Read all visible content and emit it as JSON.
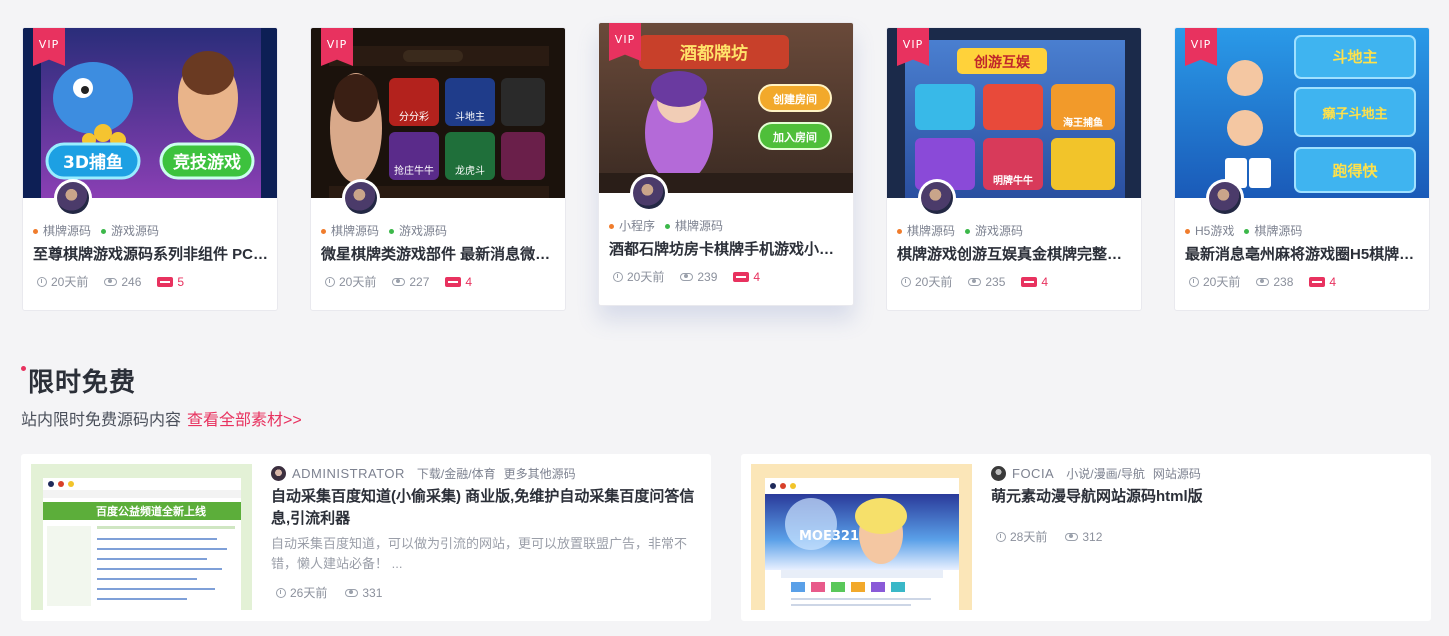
{
  "cards": [
    {
      "vip": "VIP",
      "cat1": "棋牌源码",
      "cat2": "游戏源码",
      "title": "至尊棋牌游戏源码系列非组件 PC…",
      "time": "20天前",
      "views": "246",
      "price": "5"
    },
    {
      "vip": "VIP",
      "cat1": "棋牌源码",
      "cat2": "游戏源码",
      "title": "微星棋牌类游戏部件 最新消息微…",
      "time": "20天前",
      "views": "227",
      "price": "4"
    },
    {
      "vip": "VIP",
      "cat1": "小程序",
      "cat2": "棋牌源码",
      "title": "酒都石牌坊房卡棋牌手机游戏小…",
      "time": "20天前",
      "views": "239",
      "price": "4"
    },
    {
      "vip": "VIP",
      "cat1": "棋牌源码",
      "cat2": "游戏源码",
      "title": "棋牌游戏创游互娱真金棋牌完整…",
      "time": "20天前",
      "views": "235",
      "price": "4"
    },
    {
      "vip": "VIP",
      "cat1": "H5游戏",
      "cat2": "棋牌源码",
      "title": "最新消息亳州麻将游戏圈H5棋牌…",
      "time": "20天前",
      "views": "238",
      "price": "4"
    }
  ],
  "thumb_text": {
    "c1_a": "3D捕鱼",
    "c1_b": "竞技游戏",
    "c2_a": "分分彩",
    "c2_b": "斗地主",
    "c2_c": "抢庄牛牛",
    "c2_d": "龙虎斗",
    "c3_a": "酒都牌坊",
    "c3_b": "创建房间",
    "c3_c": "加入房间",
    "c4_a": "创游互娱",
    "c4_b": "海王捕鱼",
    "c4_c": "明牌牛牛",
    "c5_a": "斗地主",
    "c5_b": "癞子斗地主",
    "c5_c": "跑得快"
  },
  "section": {
    "title": "限时免费",
    "subtitle": "站内限时免费源码内容",
    "link": "查看全部素材>>"
  },
  "list": [
    {
      "author": "ADMINISTRATOR",
      "cat1": "下载/金融/体育",
      "cat2": "更多其他源码",
      "title": "自动采集百度知道(小偷采集) 商业版,免维护自动采集百度问答信息,引流利器",
      "desc": "自动采集百度知道，可以做为引流的网站，更可以放置联盟广告，非常不错，懒人建站必备！ ...",
      "time": "26天前",
      "views": "331",
      "banner": "百度公益频道全新上线"
    },
    {
      "author": "FOCIA",
      "cat1": "小说/漫画/导航",
      "cat2": "网站源码",
      "title": "萌元素动漫导航网站源码html版",
      "desc": "",
      "time": "28天前",
      "views": "312",
      "banner": "MOE321"
    }
  ],
  "colors": {
    "accent": "#e8325f",
    "orange": "#f07c2c",
    "green": "#3cb84a"
  }
}
